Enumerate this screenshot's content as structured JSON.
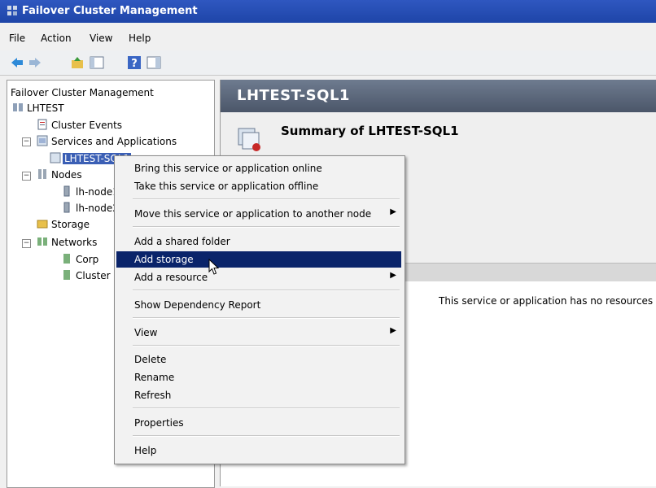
{
  "window": {
    "title": "Failover Cluster Management"
  },
  "menubar": {
    "items": [
      "File",
      "Action",
      "View",
      "Help"
    ]
  },
  "tree": {
    "root": "Failover Cluster Management",
    "cluster": "LHTEST",
    "cluster_events": "Cluster Events",
    "services": "Services and Applications",
    "selected_service": "LHTEST-SQL1",
    "nodes": "Nodes",
    "node1": "lh-node1",
    "node2": "lh-node2",
    "storage": "Storage",
    "networks": "Networks",
    "net_corp": "Corp",
    "net_cluster": "Cluster"
  },
  "main": {
    "header": "LHTEST-SQL1",
    "summary_title": "Summary of LHTEST-SQL1",
    "no_resources": "This service or application has no resources"
  },
  "context_menu": {
    "items": [
      "Bring this service or application online",
      "Take this service or application offline",
      "Move this service or application to another node",
      "Add a shared folder",
      "Add storage",
      "Add a resource",
      "Show Dependency Report",
      "View",
      "Delete",
      "Rename",
      "Refresh",
      "Properties",
      "Help"
    ],
    "highlighted": "Add storage"
  },
  "colors": {
    "title_bar": "#1e45a8",
    "highlight": "#0a246a",
    "header": "#4b5669"
  }
}
